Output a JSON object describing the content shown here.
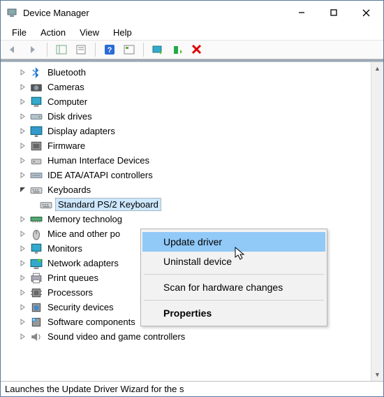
{
  "titlebar": {
    "title": "Device Manager"
  },
  "menu": {
    "file": "File",
    "action": "Action",
    "view": "View",
    "help": "Help"
  },
  "tree": {
    "items": [
      {
        "label": "Bluetooth",
        "icon": "bt"
      },
      {
        "label": "Cameras",
        "icon": "cam"
      },
      {
        "label": "Computer",
        "icon": "pc"
      },
      {
        "label": "Disk drives",
        "icon": "disk"
      },
      {
        "label": "Display adapters",
        "icon": "disp"
      },
      {
        "label": "Firmware",
        "icon": "fw"
      },
      {
        "label": "Human Interface Devices",
        "icon": "hid"
      },
      {
        "label": "IDE ATA/ATAPI controllers",
        "icon": "ide"
      },
      {
        "label": "Keyboards",
        "icon": "kb",
        "expanded": true,
        "children": [
          {
            "label": "Standard PS/2 Keyboard",
            "icon": "kb",
            "selected": true
          }
        ]
      },
      {
        "label": "Memory technolog",
        "icon": "mem"
      },
      {
        "label": "Mice and other po",
        "icon": "mouse"
      },
      {
        "label": "Monitors",
        "icon": "mon"
      },
      {
        "label": "Network adapters",
        "icon": "net"
      },
      {
        "label": "Print queues",
        "icon": "prn"
      },
      {
        "label": "Processors",
        "icon": "cpu"
      },
      {
        "label": "Security devices",
        "icon": "sec"
      },
      {
        "label": "Software components",
        "icon": "sw"
      },
      {
        "label": "Sound  video and game controllers",
        "icon": "snd"
      }
    ]
  },
  "context_menu": {
    "update": "Update driver",
    "uninstall": "Uninstall device",
    "scan": "Scan for hardware changes",
    "properties": "Properties"
  },
  "statusbar": {
    "text": "Launches the Update Driver Wizard for the s"
  }
}
